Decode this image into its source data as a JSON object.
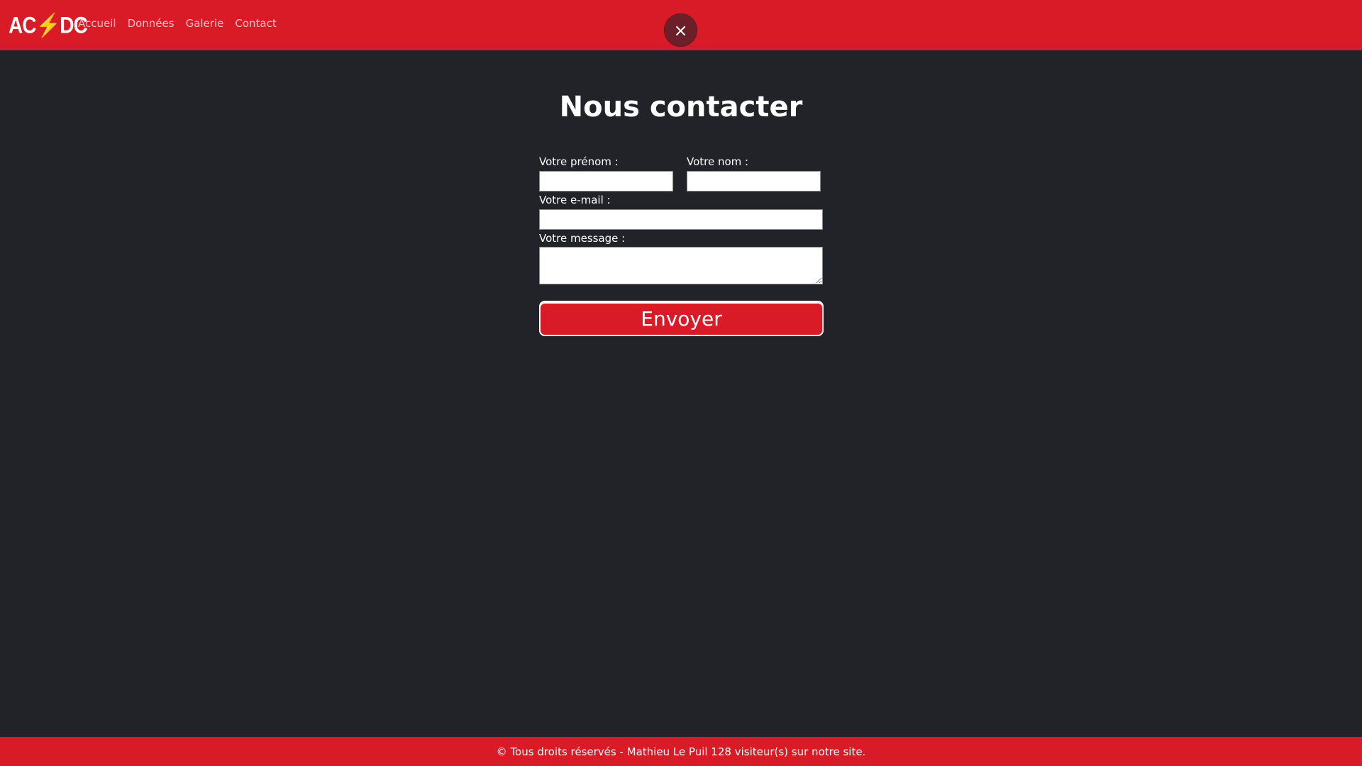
{
  "header": {
    "logo_text": "AC⚡DC",
    "nav": [
      "Accueil",
      "Données",
      "Galerie",
      "Contact"
    ],
    "close_symbol": "×"
  },
  "main": {
    "title": "Nous contacter",
    "form": {
      "firstname_label": "Votre prénom :",
      "lastname_label": "Votre nom :",
      "email_label": "Votre e-mail :",
      "message_label": "Votre message :",
      "submit_label": "Envoyer"
    }
  },
  "footer": {
    "text": "© Tous droits réservés - Mathieu Le Puil 128 visiteur(s) sur notre site."
  },
  "colors": {
    "brand_red": "#d91a27",
    "background": "#212329"
  }
}
